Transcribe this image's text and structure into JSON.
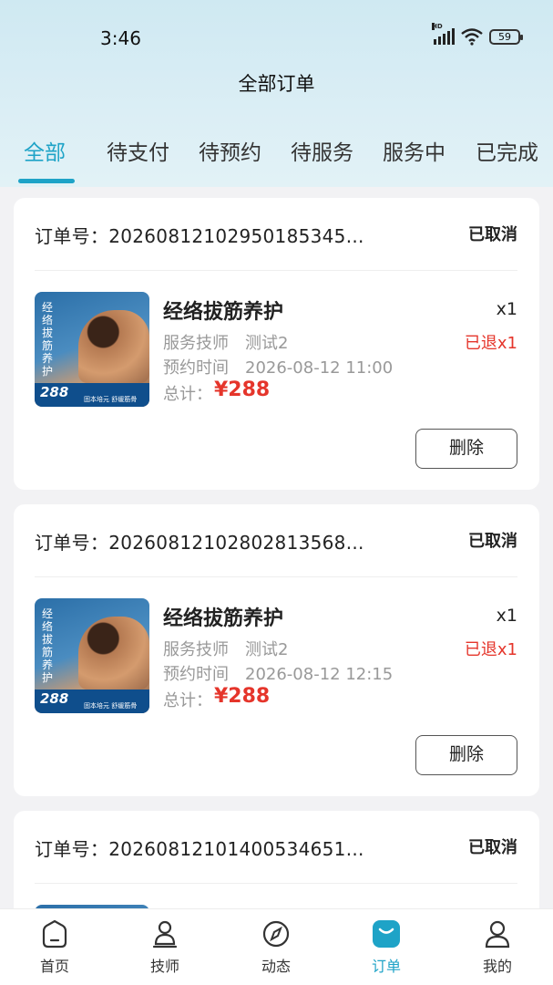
{
  "status_bar": {
    "time": "3:46",
    "battery": "59",
    "hd": "HD"
  },
  "header": {
    "title": "全部订单"
  },
  "tabs": [
    {
      "label": "全部",
      "active": true
    },
    {
      "label": "待支付",
      "active": false
    },
    {
      "label": "待预约",
      "active": false
    },
    {
      "label": "待服务",
      "active": false
    },
    {
      "label": "服务中",
      "active": false
    },
    {
      "label": "已完成",
      "active": false
    }
  ],
  "orders": [
    {
      "order_no": "订单号：20260812102950185345...",
      "status": "已取消",
      "product": {
        "name": "经络拔筋养护",
        "thumb_title": "经络拔筋养护",
        "thumb_price": "288",
        "thumb_slogan": "固本培元 舒缓筋骨"
      },
      "quantity": "x1",
      "refund": "已退x1",
      "technician_label": "服务技师",
      "technician": "测试2",
      "time_label": "预约时间",
      "time": "2026-08-12 11:00",
      "total_label": "总计：",
      "total": "¥288",
      "delete_label": "删除"
    },
    {
      "order_no": "订单号：20260812102802813568...",
      "status": "已取消",
      "product": {
        "name": "经络拔筋养护",
        "thumb_title": "经络拔筋养护",
        "thumb_price": "288",
        "thumb_slogan": "固本培元 舒缓筋骨"
      },
      "quantity": "x1",
      "refund": "已退x1",
      "technician_label": "服务技师",
      "technician": "测试2",
      "time_label": "预约时间",
      "time": "2026-08-12 12:15",
      "total_label": "总计：",
      "total": "¥288",
      "delete_label": "删除"
    },
    {
      "order_no": "订单号：20260812101400534651...",
      "status": "已取消"
    }
  ],
  "bottom_nav": [
    {
      "label": "首页",
      "icon": "home-icon",
      "active": false
    },
    {
      "label": "技师",
      "icon": "technician-icon",
      "active": false
    },
    {
      "label": "动态",
      "icon": "compass-icon",
      "active": false
    },
    {
      "label": "订单",
      "icon": "orders-icon",
      "active": true
    },
    {
      "label": "我的",
      "icon": "profile-icon",
      "active": false
    }
  ],
  "colors": {
    "accent": "#1ea3c7",
    "price": "#e5352b"
  }
}
